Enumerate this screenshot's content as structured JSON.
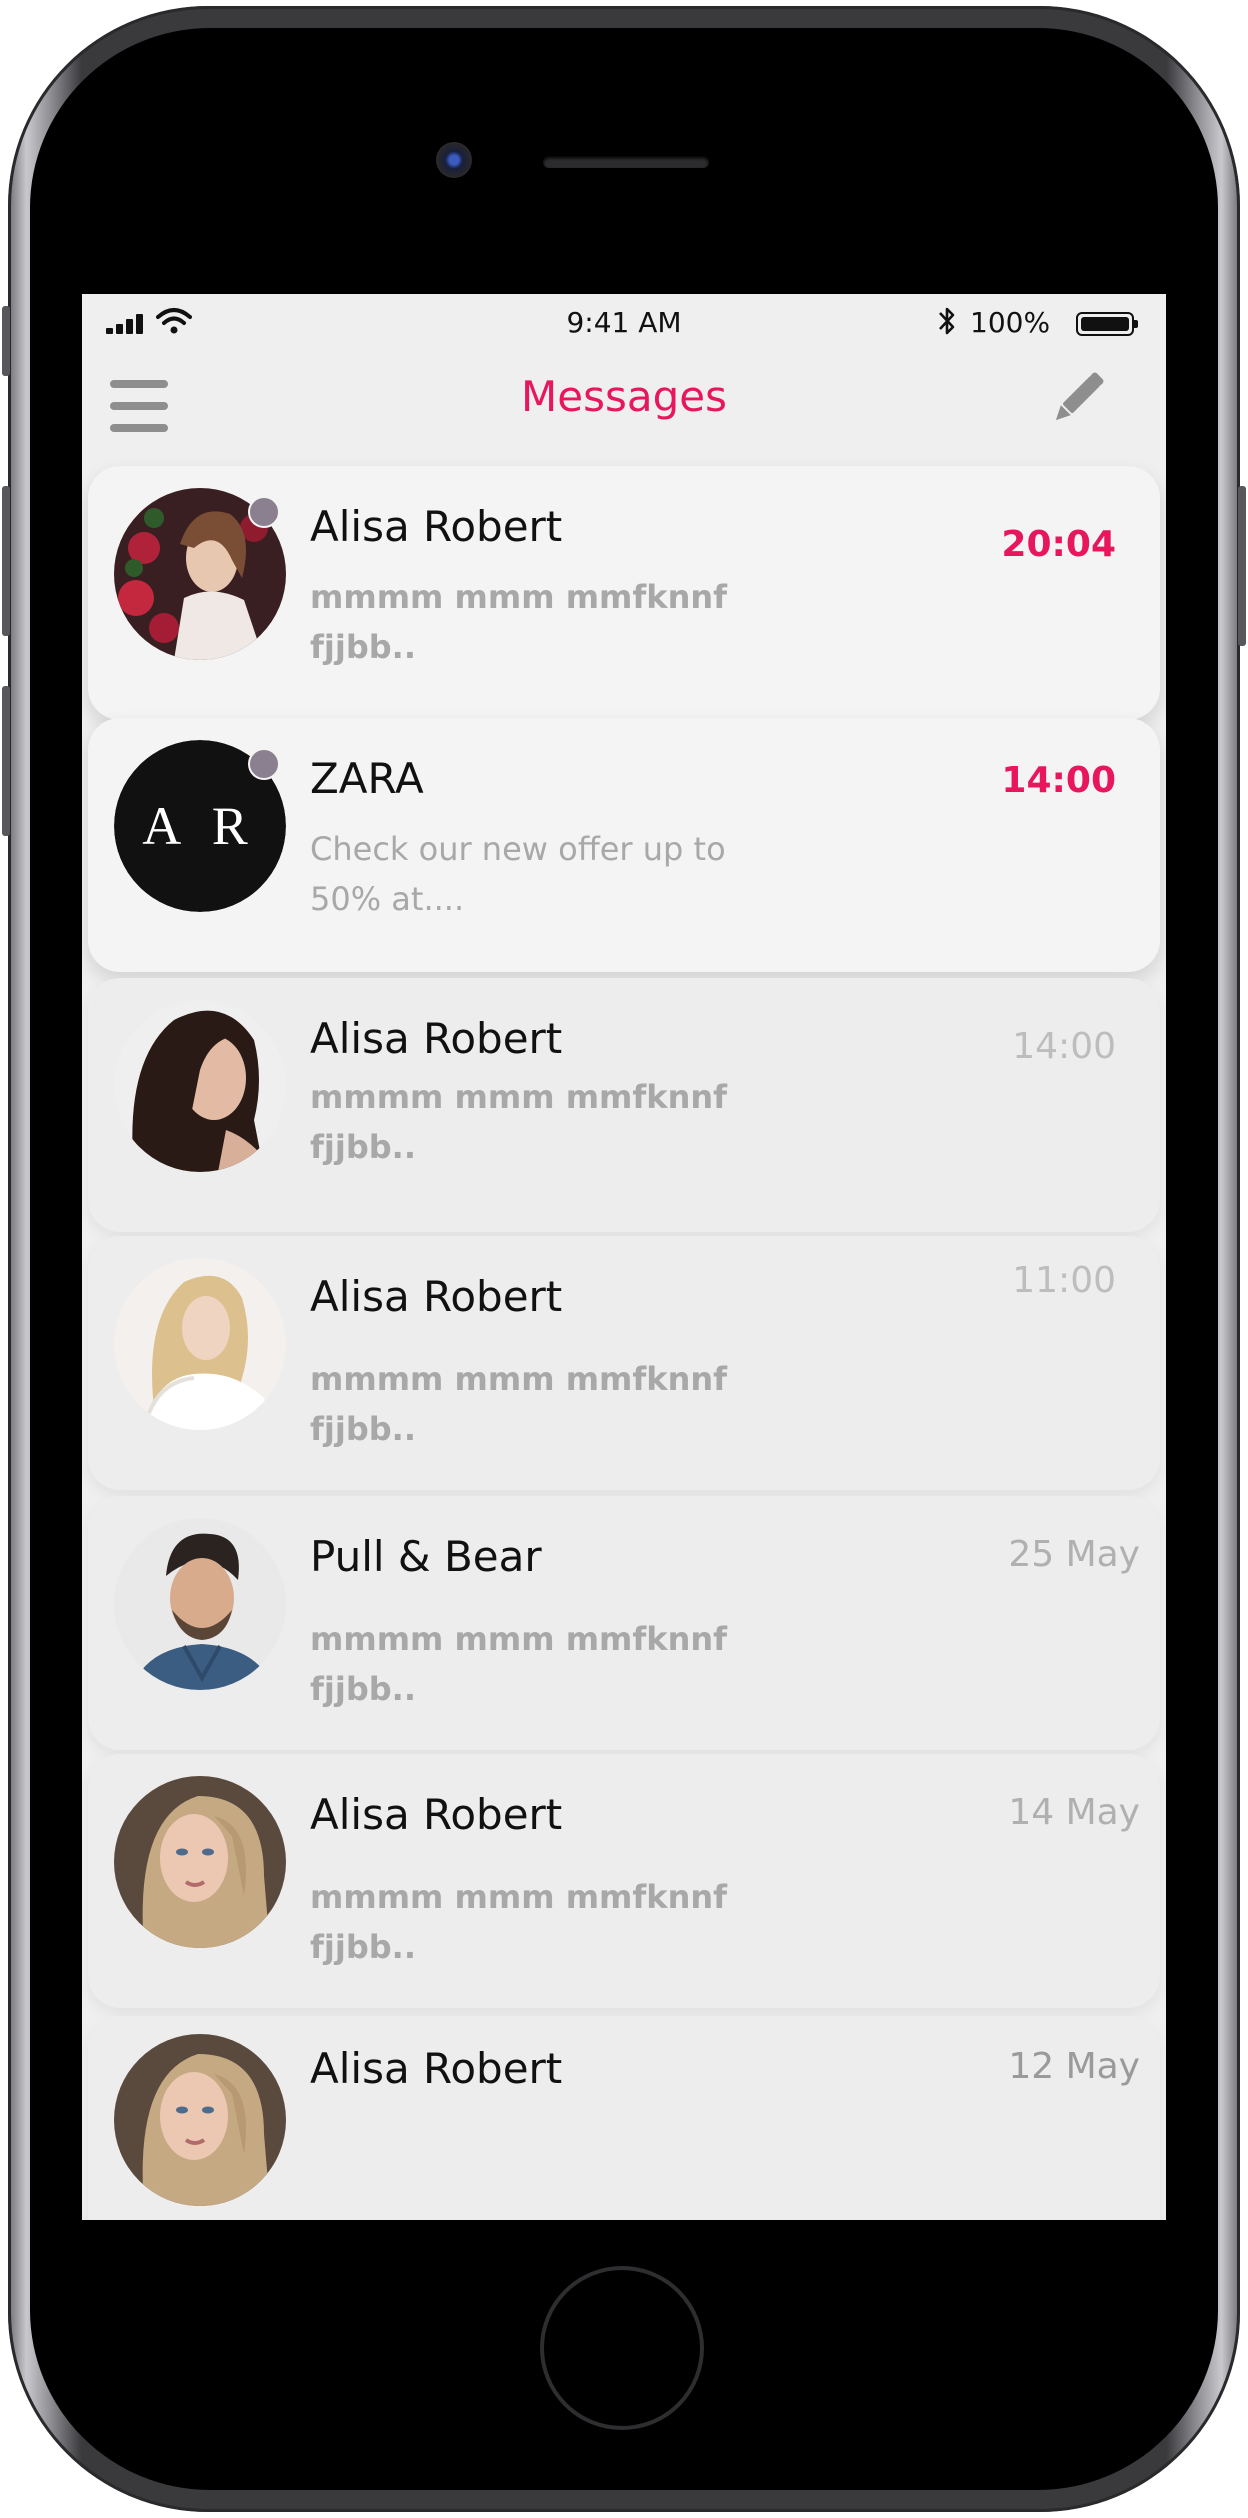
{
  "status_bar": {
    "time": "9:41 AM",
    "battery_percent": "100%",
    "icons": [
      "signal-icon",
      "wifi-icon",
      "bluetooth-icon",
      "battery-icon"
    ]
  },
  "header": {
    "title": "Messages",
    "left_icon": "menu-icon",
    "right_icon": "compose-icon"
  },
  "colors": {
    "accent": "#e8175d",
    "screen_background": "#efefef",
    "muted_text": "#a8a8a8",
    "online_dot": "#8b8090"
  },
  "conversations": [
    {
      "name": "Alisa Robert",
      "preview": "mmmm mmm mmfknnf fjjbb..",
      "time": "20:04",
      "unread": true,
      "online": true,
      "avatar": "woman-with-roses-photo"
    },
    {
      "name": "ZARA",
      "preview": "Check our new offer up to 50% at....",
      "time": "14:00",
      "unread": true,
      "online": true,
      "avatar": "zara-logo",
      "logo_text": "A R"
    },
    {
      "name": "Alisa Robert",
      "preview": "mmmm mmm mmfknnf fjjbb..",
      "time": "14:00",
      "unread": false,
      "online": false,
      "avatar": "dark-haired-woman-photo"
    },
    {
      "name": "Alisa Robert",
      "preview": "mmmm mmm mmfknnf fjjbb..",
      "time": "11:00",
      "unread": false,
      "online": false,
      "avatar": "blonde-woman-photo"
    },
    {
      "name": "Pull & Bear",
      "preview": "mmmm mmm mmfknnf fjjbb..",
      "time": "25 May",
      "unread": false,
      "online": false,
      "avatar": "man-portrait-photo"
    },
    {
      "name": "Alisa Robert",
      "preview": "mmmm mmm mmfknnf fjjbb..",
      "time": "14 May",
      "unread": false,
      "online": false,
      "avatar": "light-haired-woman-photo"
    },
    {
      "name": "Alisa Robert",
      "preview": "",
      "time": "12 May",
      "unread": false,
      "online": false,
      "avatar": "light-haired-woman-photo"
    }
  ]
}
